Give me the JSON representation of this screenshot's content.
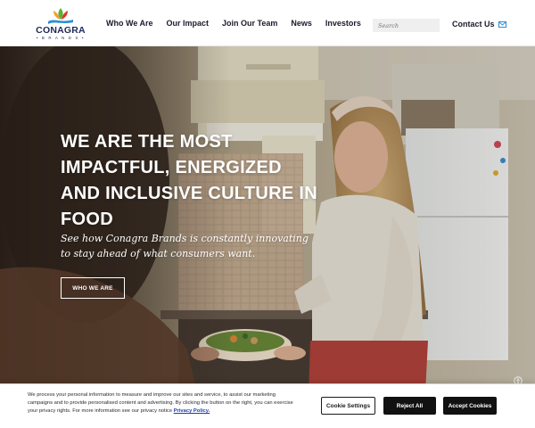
{
  "brand": {
    "name": "CONAGRA",
    "tagline": "• B R A N D S •",
    "colors": {
      "navy": "#1e2a5a",
      "leaf_green": "#5fae3a",
      "leaf_orange": "#f0a02c",
      "leaf_red": "#d7352b",
      "wave_blue": "#2c8fd6"
    }
  },
  "nav": {
    "items": [
      {
        "label": "Who We Are"
      },
      {
        "label": "Our Impact"
      },
      {
        "label": "Join Our Team"
      },
      {
        "label": "News"
      },
      {
        "label": "Investors"
      }
    ],
    "search_placeholder": "Search",
    "contact_label": "Contact Us",
    "contact_icon": "mail-icon",
    "accent": "#2c8fd6"
  },
  "hero": {
    "title": "WE ARE THE MOST IMPACTFUL, ENERGIZED AND INCLUSIVE CULTURE IN FOOD",
    "subtitle": "See how Conagra Brands is constantly innovating to stay ahead of what consumers want.",
    "button_label": "WHO WE ARE",
    "corner_icon": "accessibility-icon"
  },
  "cookie_banner": {
    "text": "We process your personal information to measure and improve our sites and service, to assist our marketing campaigns and to provide personalised content and advertising. By clicking the button on the right, you can exercise your privacy rights. For more information see our privacy notice",
    "policy_link": "Privacy Policy.",
    "settings_label": "Cookie Settings",
    "reject_label": "Reject All",
    "accept_label": "Accept Cookies"
  }
}
